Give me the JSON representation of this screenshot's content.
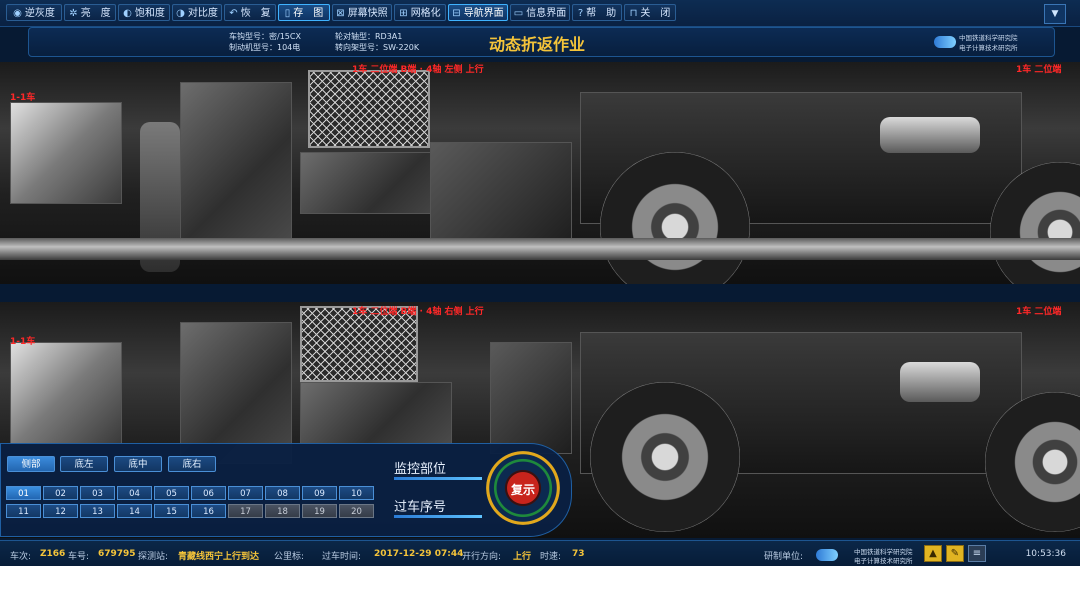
{
  "toolbar": {
    "buttons": [
      {
        "icon": "◉",
        "label": "逆灰度"
      },
      {
        "icon": "✲",
        "label": "亮　度"
      },
      {
        "icon": "◐",
        "label": "饱和度"
      },
      {
        "icon": "◑",
        "label": "对比度"
      },
      {
        "icon": "↶",
        "label": "恢　复"
      },
      {
        "icon": "▯",
        "label": "存　图"
      },
      {
        "icon": "⊠",
        "label": "屏幕快照"
      },
      {
        "icon": "⊞",
        "label": "网格化"
      },
      {
        "icon": "⊟",
        "label": "导航界面"
      },
      {
        "icon": "▭",
        "label": "信息界面"
      },
      {
        "icon": "?",
        "label": "帮　助"
      },
      {
        "icon": "⊓",
        "label": "关　闭"
      }
    ],
    "dropdown_icon": "▼"
  },
  "header": {
    "vehicle_model": "车钩型号：密/15CX",
    "brake_model": "制动机型号：104电",
    "wheelset_model": "轮对轴型：RD3A1",
    "bogie_model": "转向架型号：SW-220K",
    "title": "动态折返作业",
    "org_line1": "中国铁道科学研究院",
    "org_line2": "电子计算技术研究所"
  },
  "cameras": {
    "top_left_label": "1-1车",
    "top_center_label": "1车 二位端 B端 · 4轴 左侧 上行",
    "top_right_label": "1车 二位端",
    "bottom_left_label": "1-1车",
    "bottom_center_label": "1车 二位端 B端 · 4轴 右侧 上行",
    "bottom_right_label": "1车 二位端"
  },
  "panel": {
    "tabs": [
      "侧部",
      "底左",
      "底中",
      "底右"
    ],
    "active_tab": 0,
    "numbers": [
      "01",
      "02",
      "03",
      "04",
      "05",
      "06",
      "07",
      "08",
      "09",
      "10",
      "11",
      "12",
      "13",
      "14",
      "15",
      "16",
      "17",
      "18",
      "19",
      "20"
    ],
    "monitor_label": "监控部位",
    "sequence_label": "过车序号",
    "replay_label": "复示"
  },
  "status": {
    "train_no_k": "车次:",
    "train_no_v": "Z166",
    "car_no_k": "车号:",
    "car_no_v": "679795",
    "station_k": "探测站:",
    "station_v": "青藏线西宁上行到达",
    "km_k": "公里标:",
    "pass_time_k": "过车时间:",
    "pass_time_v": "2017-12-29 07:44",
    "direction_k": "开行方向:",
    "direction_v": "上行",
    "speed_k": "时速:",
    "speed_v": "73",
    "dev_unit_k": "研制单位:",
    "org_line1": "中国铁道科学研究院",
    "org_line2": "电子计算技术研究所",
    "clock": "10:53:36"
  },
  "colors": {
    "accent": "#f4c43a",
    "label_red": "#ff2828",
    "panel_bg": "#0a2042",
    "border": "#1f5fa3"
  }
}
